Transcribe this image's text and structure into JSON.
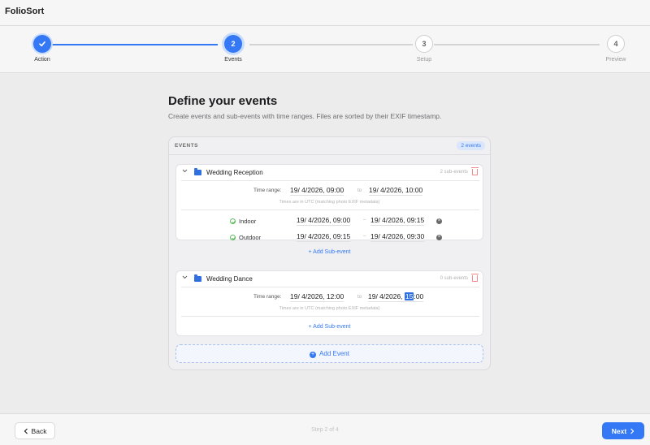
{
  "app": {
    "title": "FolioSort"
  },
  "steps": [
    {
      "number": "1",
      "label": "Action",
      "state": "done",
      "icon": "check-icon"
    },
    {
      "number": "2",
      "label": "Events",
      "state": "active"
    },
    {
      "number": "3",
      "label": "Setup",
      "state": "todo"
    },
    {
      "number": "4",
      "label": "Preview",
      "state": "todo"
    }
  ],
  "page": {
    "title": "Define your events",
    "subtitle": "Create events and sub-events with time ranges. Files are sorted by their EXIF timestamp."
  },
  "events_panel": {
    "title": "EVENTS",
    "count_badge": "2 events",
    "events": [
      {
        "name": "Wedding Reception",
        "sub_count": "2 sub-events",
        "range_label": "Time range:",
        "start": "19/  4/2026, 09:00",
        "to": "to",
        "end": "19/  4/2026, 10:00",
        "note": "Times are in UTC (matching photo EXIF metadata)",
        "sub_events": [
          {
            "name": "Indoor",
            "start": "19/  4/2026, 09:00",
            "sep": "–",
            "end": "19/  4/2026, 09:15"
          },
          {
            "name": "Outdoor",
            "start": "19/  4/2026, 09:15",
            "sep": "–",
            "end": "19/  4/2026, 09:30"
          }
        ],
        "add_sub_label": "+ Add Sub-event"
      },
      {
        "name": "Wedding Dance",
        "sub_count": "0 sub-events",
        "range_label": "Time range:",
        "start": "19/  4/2026, 12:00",
        "to": "to",
        "end_prefix": "19/  4/2026, ",
        "end_selected": "15",
        "end_suffix": ":00",
        "note": "Times are in UTC (matching photo EXIF metadata)",
        "add_sub_label": "+ Add Sub-event"
      }
    ],
    "add_event_label": "Add Event"
  },
  "footer": {
    "back_label": "Back",
    "step_counter": "Step 2 of 4",
    "next_label": "Next"
  },
  "colors": {
    "accent": "#3478f6",
    "delete": "#f08a8a",
    "success": "#5cb85c"
  }
}
